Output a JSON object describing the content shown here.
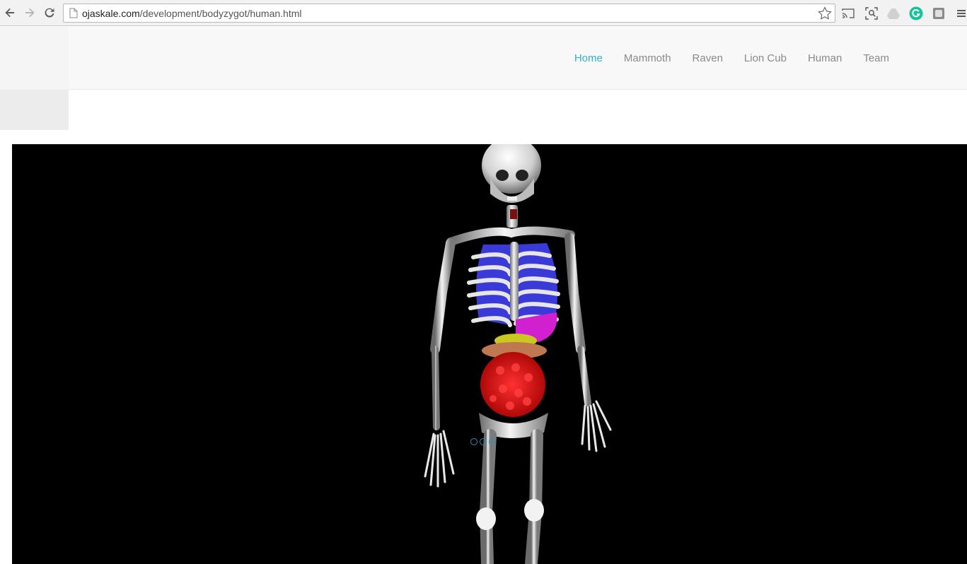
{
  "browser": {
    "url_host": "ojaskale.com",
    "url_path": "/development/bodyzygot/human.html",
    "icons": {
      "back": "back-arrow-icon",
      "forward": "forward-arrow-icon",
      "reload": "reload-icon",
      "page": "page-icon",
      "bookmark": "star-icon",
      "cast": "cast-icon",
      "screenshot": "screenshot-icon",
      "drive": "drive-icon",
      "grammarly": "grammarly-icon",
      "extension": "extension-icon",
      "menu": "menu-icon"
    }
  },
  "site": {
    "nav": [
      {
        "label": "Home",
        "active": true
      },
      {
        "label": "Mammoth",
        "active": false
      },
      {
        "label": "Raven",
        "active": false
      },
      {
        "label": "Lion Cub",
        "active": false
      },
      {
        "label": "Human",
        "active": false
      },
      {
        "label": "Team",
        "active": false
      }
    ],
    "accent_color": "#2fb3c6"
  },
  "viewer": {
    "background": "#000000",
    "model": "human skeleton with organs",
    "loader_dots": 3
  }
}
